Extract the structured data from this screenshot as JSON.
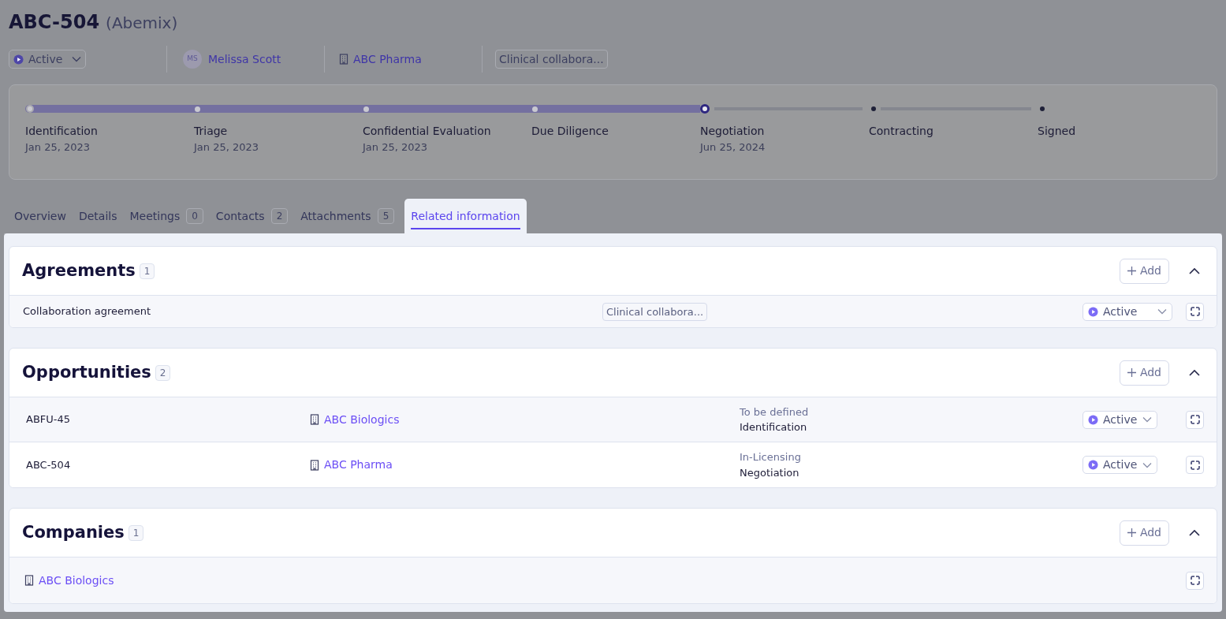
{
  "header": {
    "title": "ABC-504",
    "subtitle": "(Abemix)",
    "status": "Active",
    "owner": {
      "initials": "MS",
      "name": "Melissa Scott"
    },
    "company": "ABC Pharma",
    "tag": "Clinical collabora..."
  },
  "stages": [
    {
      "label": "Identification",
      "date": "Jan 25, 2023",
      "completed": true,
      "current": false
    },
    {
      "label": "Triage",
      "date": "Jan 25, 2023",
      "completed": true,
      "current": false
    },
    {
      "label": "Confidential Evaluation",
      "date": "Jan 25, 2023",
      "completed": true,
      "current": false
    },
    {
      "label": "Due Diligence",
      "completed": true,
      "current": false
    },
    {
      "label": "Negotiation",
      "date": "Jun 25, 2024",
      "completed": false,
      "current": true
    },
    {
      "label": "Contracting",
      "completed": false,
      "current": false
    },
    {
      "label": "Signed",
      "completed": false,
      "current": false
    }
  ],
  "tabs": [
    {
      "label": "Overview",
      "selected": false
    },
    {
      "label": "Details",
      "selected": false
    },
    {
      "label": "Meetings",
      "count": "0",
      "selected": false
    },
    {
      "label": "Contacts",
      "count": "2",
      "selected": false
    },
    {
      "label": "Attachments",
      "count": "5",
      "selected": false
    },
    {
      "label": "Related information",
      "selected": true
    }
  ],
  "sections": [
    {
      "kind": "agreements",
      "title": "Agreements",
      "count": "1",
      "add": "Add",
      "expanded": true,
      "rows": [
        {
          "name": "Collaboration agreement",
          "tag": "Clinical collabora...",
          "status": "Active"
        }
      ]
    },
    {
      "kind": "opportunities",
      "title": "Opportunities",
      "count": "2",
      "add": "Add",
      "expanded": true,
      "rows": [
        {
          "id": "ABFU-45",
          "company": "ABC Biologics",
          "type": "To be defined",
          "stage": "Identification",
          "status": "Active"
        },
        {
          "id": "ABC-504",
          "company": "ABC Pharma",
          "type": "In-Licensing",
          "stage": "Negotiation",
          "status": "Active"
        }
      ]
    },
    {
      "kind": "companies",
      "title": "Companies",
      "count": "1",
      "add": "Add",
      "expanded": true,
      "rows": [
        {
          "company": "ABC Biologics"
        }
      ]
    }
  ]
}
